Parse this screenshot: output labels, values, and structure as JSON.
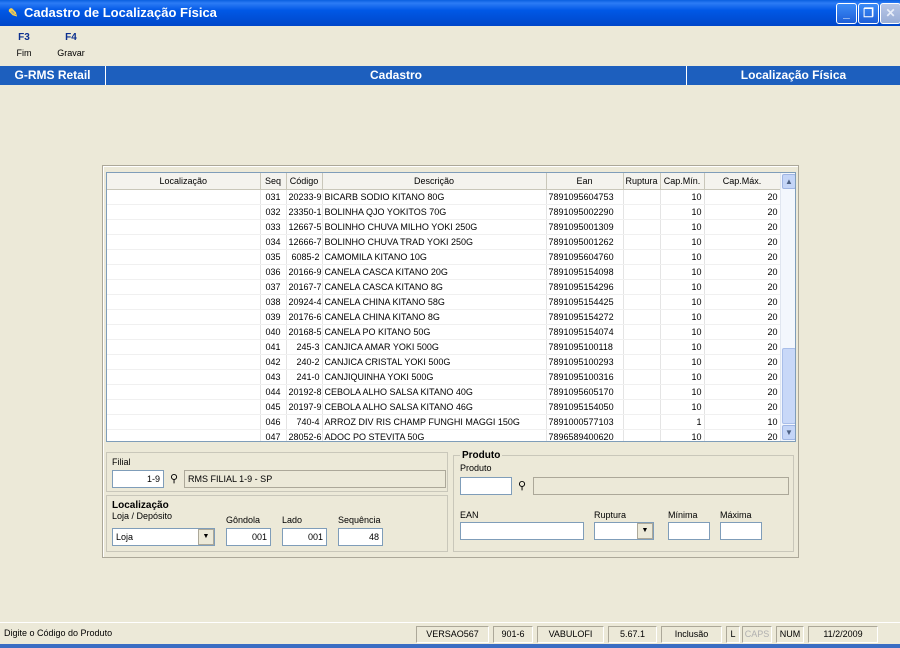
{
  "window": {
    "title": "Cadastro de Localização Física"
  },
  "toolbar": {
    "f3": {
      "key": "F3",
      "label": "Fim"
    },
    "f4": {
      "key": "F4",
      "label": "Gravar"
    }
  },
  "header": {
    "left": "G-RMS Retail",
    "center": "Cadastro",
    "right": "Localização Física"
  },
  "grid": {
    "columns": [
      "Localização",
      "Seq",
      "Código",
      "Descrição",
      "Ean",
      "Ruptura",
      "Cap.Mín.",
      "Cap.Máx."
    ],
    "rows": [
      [
        "",
        "031",
        "20233-9",
        "BICARB SODIO KITANO 80G",
        "7891095604753",
        "",
        "10",
        "20"
      ],
      [
        "",
        "032",
        "23350-1",
        "BOLINHA QJO YOKITOS 70G",
        "7891095002290",
        "",
        "10",
        "20"
      ],
      [
        "",
        "033",
        "12667-5",
        "BOLINHO CHUVA MILHO YOKI 250G",
        "7891095001309",
        "",
        "10",
        "20"
      ],
      [
        "",
        "034",
        "12666-7",
        "BOLINHO CHUVA TRAD YOKI 250G",
        "7891095001262",
        "",
        "10",
        "20"
      ],
      [
        "",
        "035",
        "6085-2",
        "CAMOMILA KITANO 10G",
        "7891095604760",
        "",
        "10",
        "20"
      ],
      [
        "",
        "036",
        "20166-9",
        "CANELA CASCA KITANO 20G",
        "7891095154098",
        "",
        "10",
        "20"
      ],
      [
        "",
        "037",
        "20167-7",
        "CANELA CASCA KITANO 8G",
        "7891095154296",
        "",
        "10",
        "20"
      ],
      [
        "",
        "038",
        "20924-4",
        "CANELA CHINA KITANO 58G",
        "7891095154425",
        "",
        "10",
        "20"
      ],
      [
        "",
        "039",
        "20176-6",
        "CANELA CHINA KITANO 8G",
        "7891095154272",
        "",
        "10",
        "20"
      ],
      [
        "",
        "040",
        "20168-5",
        "CANELA PO KITANO 50G",
        "7891095154074",
        "",
        "10",
        "20"
      ],
      [
        "",
        "041",
        "245-3",
        "CANJICA AMAR YOKI 500G",
        "7891095100118",
        "",
        "10",
        "20"
      ],
      [
        "",
        "042",
        "240-2",
        "CANJICA CRISTAL YOKI 500G",
        "7891095100293",
        "",
        "10",
        "20"
      ],
      [
        "",
        "043",
        "241-0",
        "CANJIQUINHA YOKI 500G",
        "7891095100316",
        "",
        "10",
        "20"
      ],
      [
        "",
        "044",
        "20192-8",
        "CEBOLA ALHO SALSA KITANO 40G",
        "7891095605170",
        "",
        "10",
        "20"
      ],
      [
        "",
        "045",
        "20197-9",
        "CEBOLA ALHO SALSA KITANO 46G",
        "7891095154050",
        "",
        "10",
        "20"
      ],
      [
        "",
        "046",
        "740-4",
        "ARROZ DIV RIS CHAMP FUNGHI MAGGI 150G",
        "7891000577103",
        "",
        "1",
        "10"
      ],
      [
        "",
        "047",
        "28052-6",
        "ADOC PO STEVITA 50G",
        "7896589400620",
        "",
        "10",
        "20"
      ]
    ]
  },
  "filial": {
    "label": "Filial",
    "code": "1-9",
    "name": "RMS FILIAL 1-9 - SP"
  },
  "localizacao": {
    "section": "Localização",
    "tipo_label": "Loja / Depósito",
    "tipo_value": "Loja",
    "gondola_label": "Gôndola",
    "gondola_value": "001",
    "lado_label": "Lado",
    "lado_value": "001",
    "sequencia_label": "Sequência",
    "sequencia_value": "48"
  },
  "produto": {
    "section": "Produto",
    "produto_label": "Produto",
    "produto_value": "",
    "descricao_value": "",
    "ean_label": "EAN",
    "ean_value": "",
    "ruptura_label": "Ruptura",
    "ruptura_value": "",
    "minima_label": "Mínima",
    "minima_value": "",
    "maxima_label": "Máxima",
    "maxima_value": ""
  },
  "status": {
    "message": "Digite o Código do Produto",
    "version": "VERSAO567",
    "code": "901-6",
    "user": "VABULOFI",
    "build": "5.67.1",
    "mode": "Inclusão",
    "l": "L",
    "caps": "CAPS",
    "num": "NUM",
    "date": "11/2/2009"
  }
}
